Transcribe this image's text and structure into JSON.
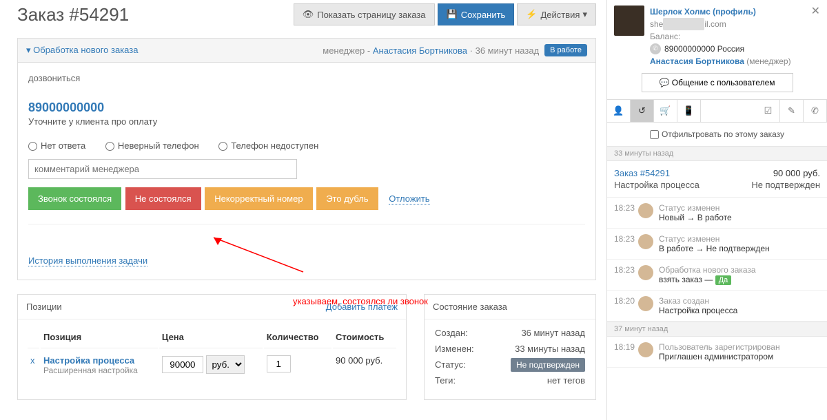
{
  "header": {
    "title": "Заказ #54291",
    "show_page": "Показать страницу заказа",
    "save": "Сохранить",
    "actions": "Действия"
  },
  "task_panel": {
    "title": "Обработка нового заказа",
    "meta_manager_label": "менеджер - ",
    "meta_manager": "Анастасия Бортникова",
    "meta_time": "36 минут назад",
    "badge": "В работе",
    "dozvon": "дозвониться",
    "phone": "89000000000",
    "phone_sub": "Уточните у клиента про оплату",
    "radio1": "Нет ответа",
    "radio2": "Неверный телефон",
    "radio3": "Телефон недоступен",
    "comment_placeholder": "комментарий менеджера",
    "btn_done": "Звонок состоялся",
    "btn_fail": "Не состоялся",
    "btn_bad": "Некорректный номер",
    "btn_dup": "Это дубль",
    "postpone": "Отложить",
    "history_link": "История выполнения задачи",
    "annotation": "указываем, состоялся ли звонок"
  },
  "positions": {
    "title": "Позиции",
    "add_payment": "Добавить платеж",
    "col_pos": "Позиция",
    "col_price": "Цена",
    "col_qty": "Количество",
    "col_cost": "Стоимость",
    "row": {
      "x": "x",
      "name": "Настройка процесса",
      "sub": "Расширенная настройка",
      "price": "90000",
      "currency": "руб.",
      "qty": "1",
      "cost": "90 000 руб."
    }
  },
  "order_status": {
    "title": "Состояние заказа",
    "created_lbl": "Создан:",
    "created_val": "36 минут назад",
    "changed_lbl": "Изменен:",
    "changed_val": "33 минуты назад",
    "status_lbl": "Статус:",
    "status_val": "Не подтвержден",
    "tags_lbl": "Теги:",
    "tags_val": "нет тегов"
  },
  "sidebar": {
    "profile": {
      "name": "Шерлок Холмс",
      "profile_label": "(профиль)",
      "email_pre": "she",
      "email_post": "il.com",
      "balance_lbl": "Баланс:",
      "phone": "89000000000 Россия",
      "manager": "Анастасия Бортникова",
      "manager_role": "(менеджер)",
      "chat_btn": "Общение с пользователем"
    },
    "filter": "Отфильтровать по этому заказу",
    "sep1": "33 минуты назад",
    "summary": {
      "order": "Заказ #54291",
      "amount": "90 000 руб.",
      "name": "Настройка процесса",
      "status": "Не подтвержден"
    },
    "log": [
      {
        "time": "18:23",
        "t1": "Статус изменен",
        "t2": "Новый → В работе"
      },
      {
        "time": "18:23",
        "t1": "Статус изменен",
        "t2": "В работе → Не подтвержден"
      },
      {
        "time": "18:23",
        "t1": "Обработка нового заказа",
        "t2_pre": "взять заказ — ",
        "t2_badge": "Да"
      },
      {
        "time": "18:20",
        "t1": "Заказ создан",
        "t2": "Настройка процесса"
      }
    ],
    "sep2": "37 минут назад",
    "log2": [
      {
        "time": "18:19",
        "t1": "Пользователь зарегистрирован",
        "t2": "Приглашен администратором"
      }
    ]
  }
}
